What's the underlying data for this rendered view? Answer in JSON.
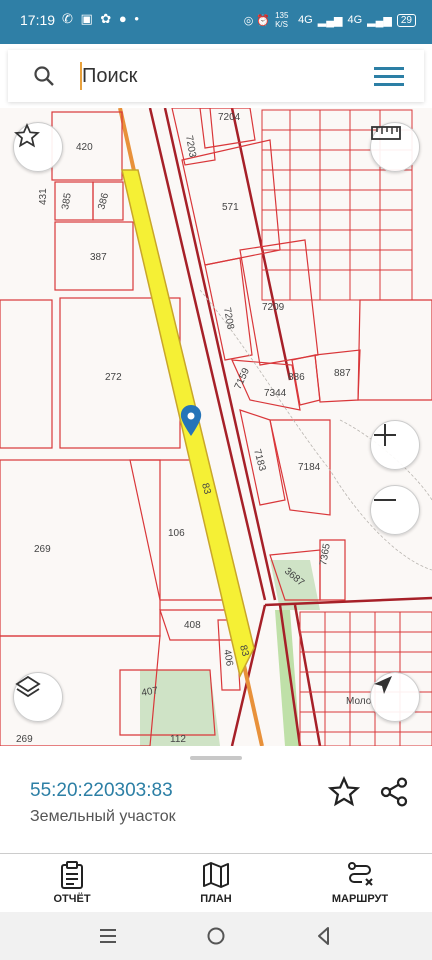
{
  "status": {
    "time": "17:19",
    "notification_icons": "✆ ▣ ✿ ● •",
    "right_icons": "◎ ⏰",
    "speed": "135 K/S",
    "signal1": "4G",
    "signal2": "4G",
    "battery": "29"
  },
  "search": {
    "placeholder": "Поиск"
  },
  "map": {
    "parcels": [
      "420",
      "7203",
      "7204",
      "431",
      "385",
      "386",
      "571",
      "387",
      "7208",
      "7209",
      "272",
      "7159",
      "7344",
      "886",
      "887",
      "7183",
      "7184",
      "83",
      "106",
      "269",
      "3687",
      "7365",
      "408",
      "406",
      "83",
      "407",
      "112",
      "269"
    ],
    "street_label": "Моло"
  },
  "parcel": {
    "cadastral_number": "55:20:220303:83",
    "type": "Земельный участок"
  },
  "nav": {
    "report": "ОТЧЁТ",
    "plan": "ПЛАН",
    "route": "МАРШРУТ"
  },
  "colors": {
    "accent": "#2c7fa5",
    "statusbar": "#2f7fa6",
    "parcel_border": "#d9373a",
    "selection_fill": "#f5f035"
  }
}
